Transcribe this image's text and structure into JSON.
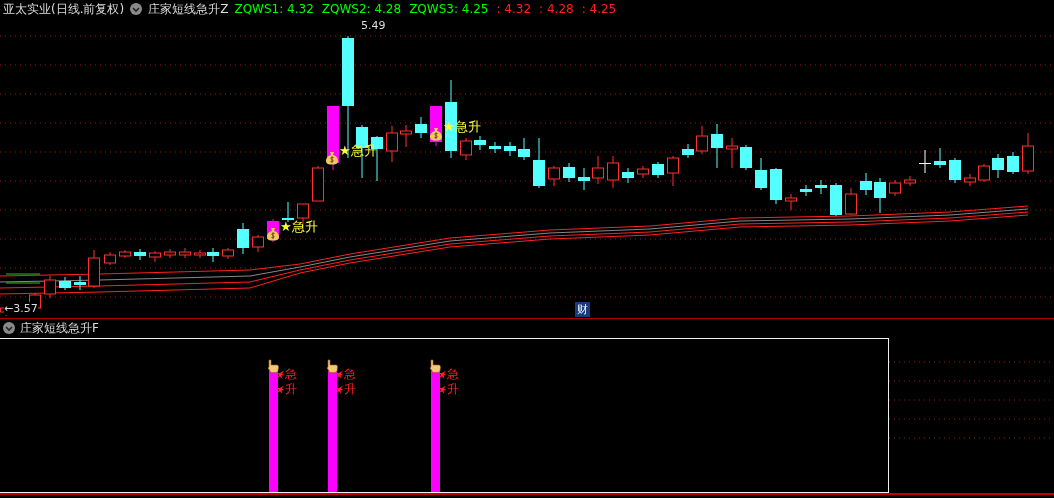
{
  "main_panel": {
    "stock_name": "亚太实业(日线.前复权)",
    "indicator_name": "庄家短线急升Z",
    "readings": [
      {
        "text": "ZQWS1: 4.32",
        "color": "#00ff00"
      },
      {
        "text": "ZQWS2: 4.28",
        "color": "#00ff00"
      },
      {
        "text": "ZQWS3: 4.25",
        "color": "#00ff00"
      },
      {
        "text": ": 4.32",
        "color": "#ff2020"
      },
      {
        "text": ": 4.28",
        "color": "#ff2020"
      },
      {
        "text": ": 4.25",
        "color": "#ff2020"
      }
    ],
    "high_label": "5.49",
    "low_label": "←3.57",
    "signals": [
      {
        "text": "★急升"
      },
      {
        "text": "★急升"
      },
      {
        "text": "★急升"
      }
    ],
    "finance_badge": "财"
  },
  "sub_panel": {
    "indicator_name": "庄家短线急升F",
    "signals": [
      {
        "line_1": "急",
        "line_2": "升"
      },
      {
        "line_1": "急",
        "line_2": "升"
      },
      {
        "line_1": "急",
        "line_2": "升"
      }
    ]
  }
}
